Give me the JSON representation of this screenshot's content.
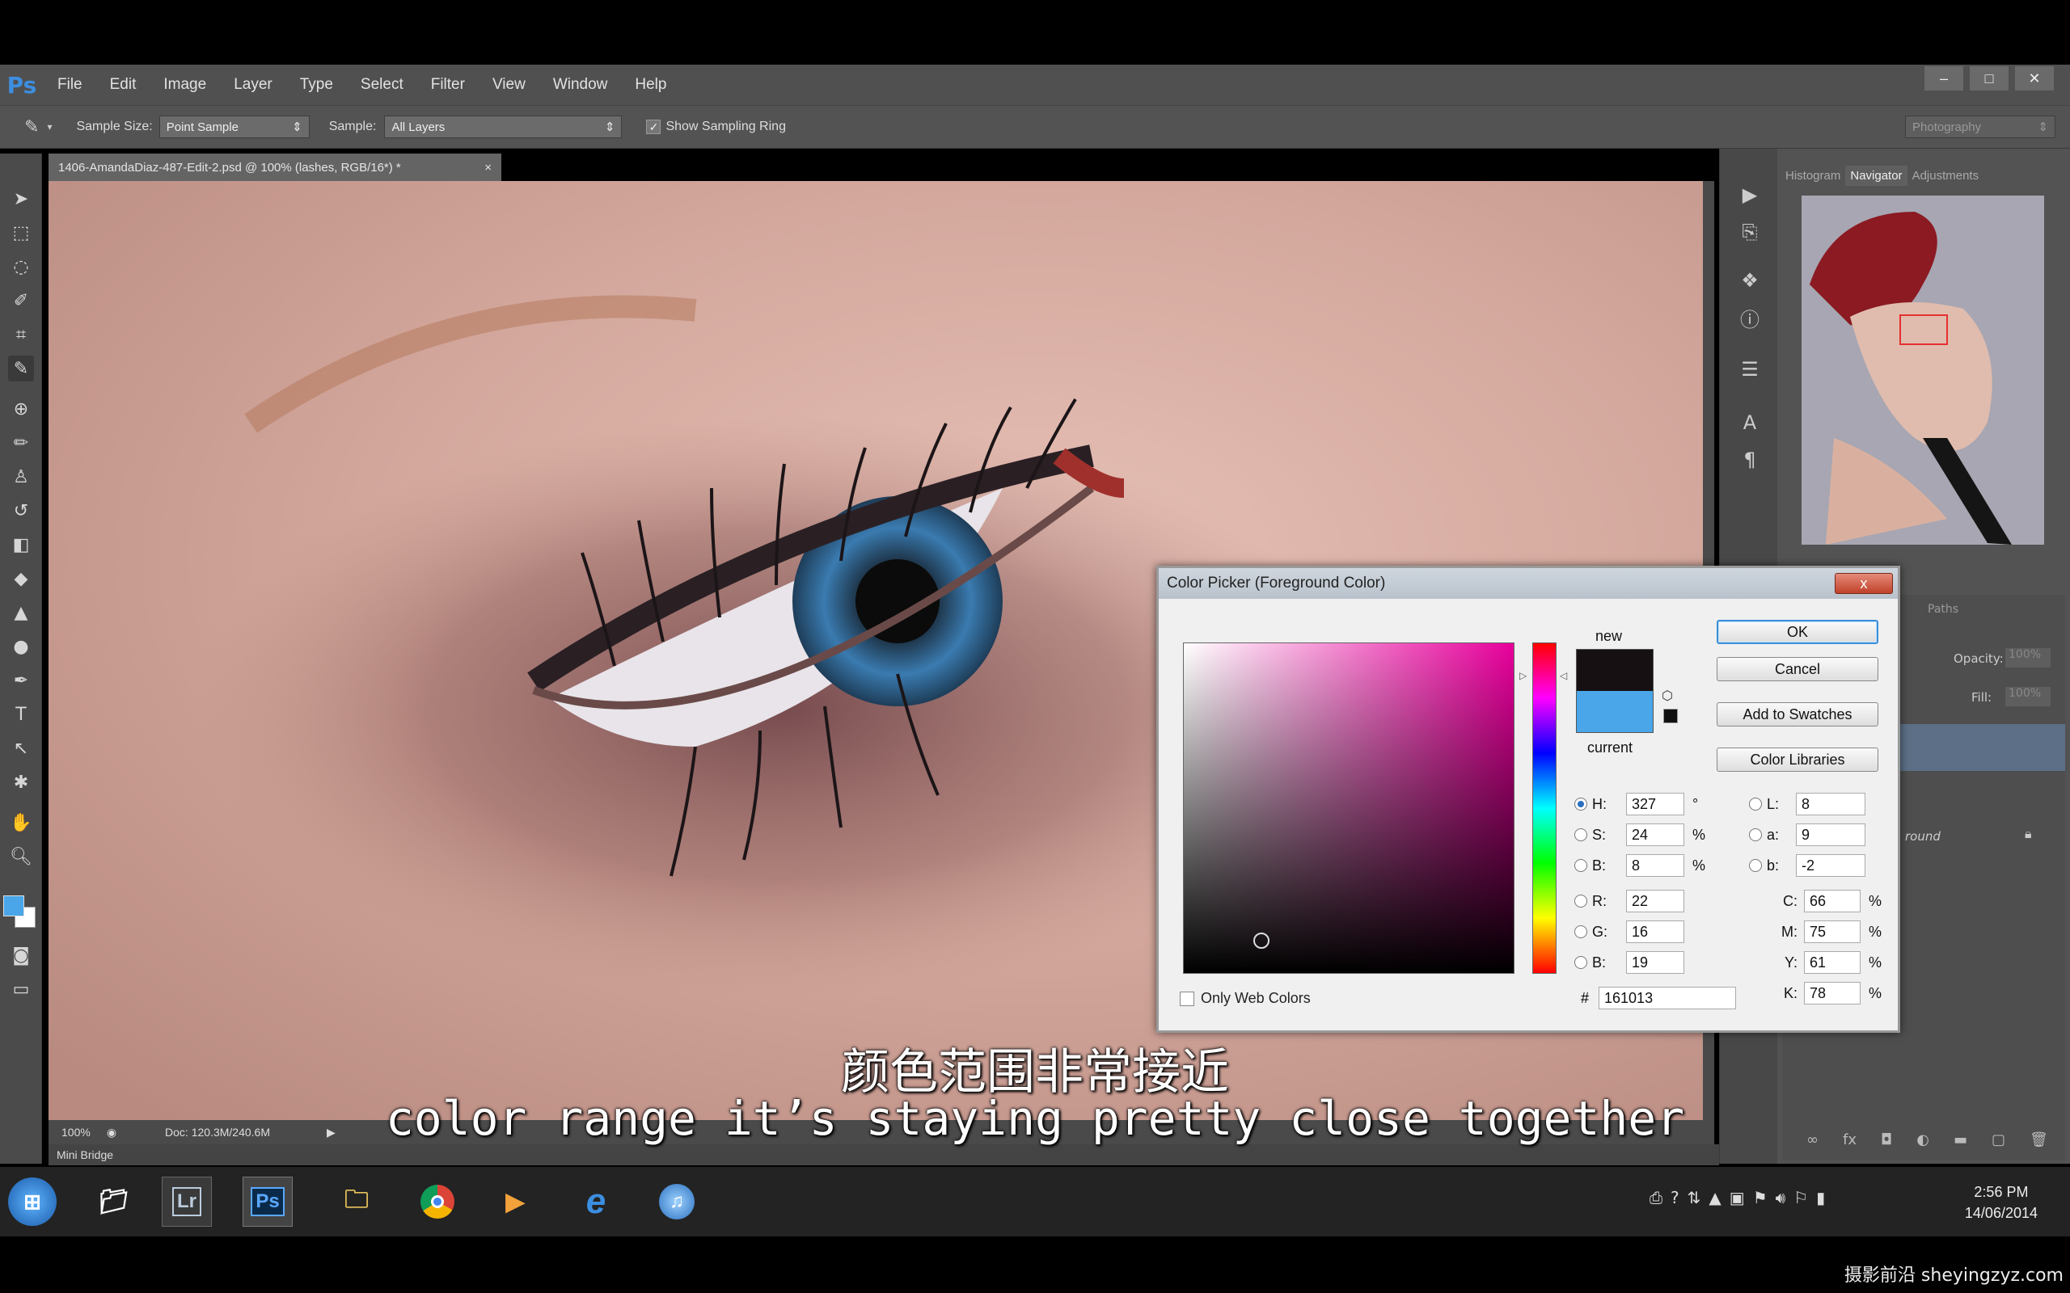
{
  "app": {
    "logo": "Ps"
  },
  "menu": [
    "File",
    "Edit",
    "Image",
    "Layer",
    "Type",
    "Select",
    "Filter",
    "View",
    "Window",
    "Help"
  ],
  "window_controls": {
    "minimize": "–",
    "maximize": "□",
    "close": "✕"
  },
  "options_bar": {
    "sample_size_label": "Sample Size:",
    "sample_size_value": "Point Sample",
    "sample_label": "Sample:",
    "sample_value": "All Layers",
    "show_sampling_ring_label": "Show Sampling Ring",
    "show_sampling_ring_checked": true,
    "workspace": "Photography"
  },
  "document": {
    "tab_title": "1406-AmandaDiaz-487-Edit-2.psd @ 100% (lashes, RGB/16*) *",
    "tab_close": "×",
    "zoom": "100%",
    "doc_size": "Doc: 120.3M/240.6M"
  },
  "mini_bridge": "Mini Bridge",
  "panels": {
    "tabs": [
      "Histogram",
      "Navigator",
      "Adjustments"
    ],
    "active_tab": "Navigator",
    "layers_tab": "Paths",
    "opacity_label": "Opacity:",
    "opacity_value": "100%",
    "fill_label": "Fill:",
    "fill_value": "100%",
    "layer_name": "round"
  },
  "color_picker": {
    "title": "Color Picker (Foreground Color)",
    "close": "x",
    "new_label": "new",
    "current_label": "current",
    "new_color": "#161013",
    "current_color": "#4aa6e8",
    "buttons": {
      "ok": "OK",
      "cancel": "Cancel",
      "add_to_swatches": "Add to Swatches",
      "color_libraries": "Color Libraries"
    },
    "hsb": {
      "h": "327",
      "s": "24",
      "b": "8",
      "h_unit": "°",
      "s_unit": "%",
      "b_unit": "%"
    },
    "rgb": {
      "r": "22",
      "g": "16",
      "b": "19"
    },
    "lab": {
      "l": "8",
      "a": "9",
      "b": "-2"
    },
    "cmyk": {
      "c": "66",
      "m": "75",
      "y": "61",
      "k": "78",
      "unit": "%"
    },
    "hex": "161013",
    "hex_label": "#",
    "labels": {
      "h": "H:",
      "s": "S:",
      "b": "B:",
      "r": "R:",
      "g": "G:",
      "b2": "B:",
      "l": "L:",
      "a": "a:",
      "lb": "b:",
      "c": "C:",
      "m": "M:",
      "y": "Y:",
      "k": "K:"
    },
    "only_web_colors": "Only Web Colors",
    "hue_color": "#e8009c"
  },
  "subtitles": {
    "zh": "颜色范围非常接近",
    "en": "color range it’s staying pretty close together"
  },
  "taskbar": {
    "apps": [
      "Lr",
      "Ps"
    ],
    "time": "2:56 PM",
    "date": "14/06/2014"
  },
  "watermark": "摄影前沿 sheyingzyz.com"
}
